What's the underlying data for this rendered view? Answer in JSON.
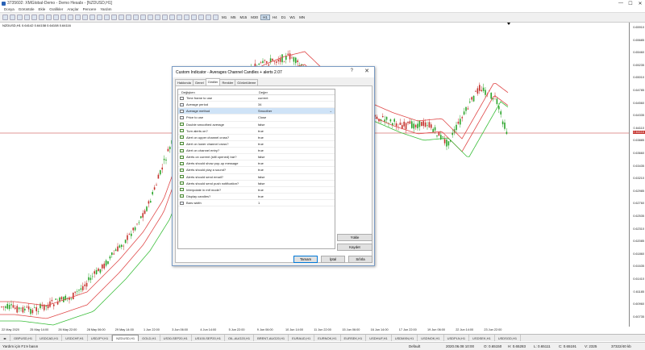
{
  "window": {
    "title": "3735602: XMGlobal-Demo - Demo Hesabı - [NZDUSD,H1]",
    "controls": [
      "—",
      "☐",
      "✕"
    ]
  },
  "menu": [
    "Dosya",
    "Görüntüle",
    "Ekle",
    "Grafikler",
    "Araçlar",
    "Pencere",
    "Yardım"
  ],
  "toolbar": {
    "timeframes": [
      "M1",
      "M5",
      "M15",
      "M30",
      "H1",
      "H4",
      "D1",
      "W1",
      "MN"
    ],
    "active_timeframe": "H1"
  },
  "chart": {
    "symbol_line": "NZDUSD,H1  0.64142 0.64158 0.64108 0.64116",
    "price_labels": [
      "0.65910",
      "0.65685",
      "0.65460",
      "0.65235",
      "0.65010",
      "0.64785",
      "0.64560",
      "0.64335",
      "0.64110",
      "0.63885",
      "0.63660",
      "0.63435",
      "0.63210",
      "0.62985",
      "0.62760",
      "0.62535",
      "0.62310",
      "0.62085",
      "0.61860",
      "0.61635",
      "0.61410",
      "0.61185",
      "0.60960",
      "0.60735"
    ],
    "current_price": "0.64116",
    "time_labels": [
      "22 May 2020",
      "25 May 14:00",
      "26 May 22:00",
      "28 May 06:00",
      "29 May 14:00",
      "1 Jun 22:00",
      "3 Jun 06:00",
      "4 Jun 14:00",
      "5 Jun 22:00",
      "9 Jun 06:00",
      "10 Jun 14:00",
      "11 Jun 22:00",
      "15 Jun 06:00",
      "16 Jun 14:00",
      "17 Jun 22:00",
      "19 Jun 06:00",
      "22 Jun 14:00",
      "23 Jun 22:00"
    ]
  },
  "tabs": [
    "GBPUSD,H1",
    "USDCAD,H1",
    "USDCHF,H1",
    "USDJPY,H1",
    "NZDUSD,H1",
    "GOLD,H1",
    "US30-SEP20,H1",
    "US100-SEP20,H1",
    "OIL-AUG20,H1",
    "BRENT-AUG20,H1",
    "EURAUD,H1",
    "EURNOK,H1",
    "EURSEK,H1",
    "USDHUF,H1",
    "USDMXN,H1",
    "USDNOK,H1",
    "USDPLN,H1",
    "USDSEK,H1",
    "USDSGD,H1"
  ],
  "active_tab": "NZDUSD,H1",
  "status": {
    "help": "Yardım için F1'e basın",
    "profile": "Default",
    "datetime": "2020.06.08 10:00",
    "open": "O: 0.65150",
    "high": "H: 0.65283",
    "low": "L: 0.65111",
    "close": "C: 0.65191",
    "volume": "V: 2325",
    "traffic": "37322/40 kb"
  },
  "dialog": {
    "title": "Custom Indicator - Averages Channel Candles + alerts 2.07",
    "help": "?",
    "close": "✕",
    "tabs": [
      "Hakkında",
      "Genel",
      "Girdiler",
      "Renkler",
      "Görüntüleme"
    ],
    "active_tab": "Girdiler",
    "col_variable": "Değişken",
    "col_value": "Değer",
    "params": [
      {
        "name": "Time frame to use",
        "value": "current",
        "type": "ab"
      },
      {
        "name": "Average period",
        "value": "34",
        "type": "123"
      },
      {
        "name": "Average method",
        "value": "Smoother",
        "type": "ab",
        "selected": true
      },
      {
        "name": "Price to use",
        "value": "Close",
        "type": "ab"
      },
      {
        "name": "Double smoothed average",
        "value": "false",
        "type": "bool"
      },
      {
        "name": "Turn alerts on?",
        "value": "true",
        "type": "bool"
      },
      {
        "name": "Alert on upper channel cross?",
        "value": "true",
        "type": "bool"
      },
      {
        "name": "Alert on lower channel cross?",
        "value": "true",
        "type": "bool"
      },
      {
        "name": "Alert on channel entry?",
        "value": "true",
        "type": "bool"
      },
      {
        "name": "Alerts on current (still opened) bar?",
        "value": "false",
        "type": "bool"
      },
      {
        "name": "Alerts should show pop-up message",
        "value": "true",
        "type": "bool"
      },
      {
        "name": "Alerts should play a sound?",
        "value": "true",
        "type": "bool"
      },
      {
        "name": "Alerts should send email?",
        "value": "false",
        "type": "bool"
      },
      {
        "name": "Alerts should send push notification?",
        "value": "false",
        "type": "bool"
      },
      {
        "name": "Interpolate in mtf mode?",
        "value": "true",
        "type": "bool"
      },
      {
        "name": "Display candles?",
        "value": "true",
        "type": "bool"
      },
      {
        "name": "Bars width",
        "value": "1",
        "type": "123"
      }
    ],
    "load_label": "Yükle",
    "save_label": "Kaydet",
    "ok_label": "Tamam",
    "cancel_label": "İptal",
    "reset_label": "Sıfırla"
  }
}
